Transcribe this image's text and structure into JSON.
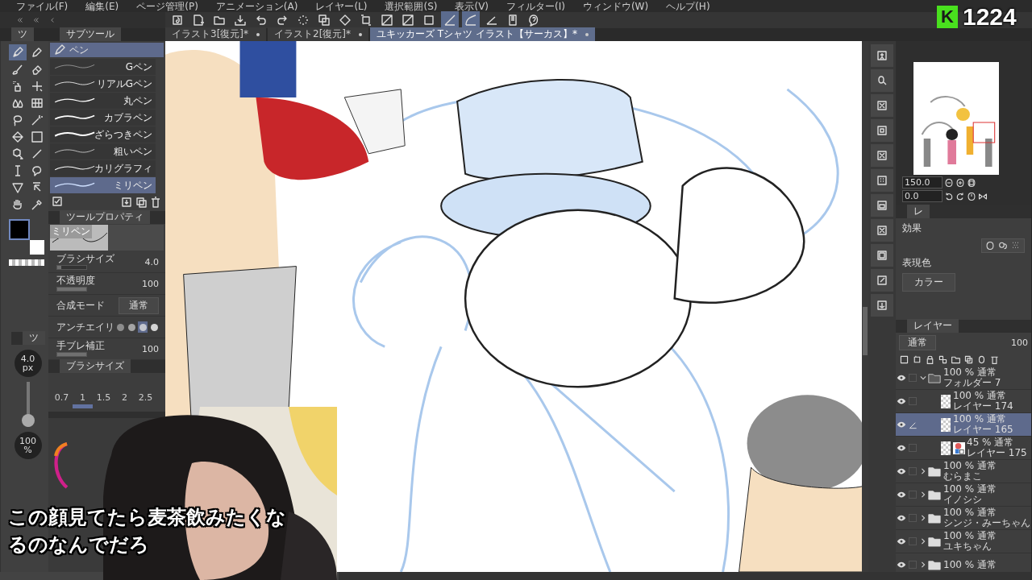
{
  "menu": [
    "ファイル(F)",
    "編集(E)",
    "ページ管理(P)",
    "アニメーション(A)",
    "レイヤー(L)",
    "選択範囲(S)",
    "表示(V)",
    "フィルター(I)",
    "ウィンドウ(W)",
    "ヘルプ(H)"
  ],
  "tool_panel_tab": "ツ",
  "subtool_panel_tab": "サブツール",
  "document_tabs": [
    {
      "label": "イラスト3[復元]*",
      "selected": false
    },
    {
      "label": "イラスト2[復元]*",
      "selected": false
    },
    {
      "label": "ユキッカーズ Tシャツ イラスト【サーカス】*",
      "selected": true
    }
  ],
  "tools": [
    {
      "selected": true
    },
    {
      "selected": false
    },
    {
      "selected": false
    },
    {
      "selected": false
    },
    {
      "selected": false
    },
    {
      "selected": false
    },
    {
      "selected": false
    },
    {
      "selected": false
    },
    {
      "selected": false
    },
    {
      "selected": false
    },
    {
      "selected": false
    },
    {
      "selected": false
    },
    {
      "selected": false
    },
    {
      "selected": false
    },
    {
      "selected": false
    },
    {
      "selected": false
    },
    {
      "selected": false
    },
    {
      "selected": false
    },
    {
      "selected": false
    },
    {
      "selected": false
    }
  ],
  "subtool": {
    "group": "ペン",
    "brushes": [
      {
        "name": "Gペン",
        "selected": false
      },
      {
        "name": "リアルGペン",
        "selected": false
      },
      {
        "name": "丸ペン",
        "selected": false
      },
      {
        "name": "カブラペン",
        "selected": false
      },
      {
        "name": "ざらつきペン",
        "selected": false
      },
      {
        "name": "粗いペン",
        "selected": false
      },
      {
        "name": "カリグラフィ",
        "selected": false
      },
      {
        "name": "ミリペン",
        "selected": true
      }
    ]
  },
  "tool_property": {
    "tab": "ツールプロパティ",
    "preview_label": "ミリペン",
    "rows": [
      {
        "kind": "slider",
        "label": "ブラシサイズ",
        "value": "4.0",
        "level": 0.15
      },
      {
        "kind": "slider",
        "label": "不透明度",
        "value": "100",
        "level": 1
      },
      {
        "kind": "select",
        "label": "合成モード",
        "value": "通常"
      },
      {
        "kind": "antialias",
        "label": "アンチエイリ",
        "options": [
          {
            "selected": false
          },
          {
            "selected": false
          },
          {
            "selected": true
          },
          {
            "selected": false
          }
        ]
      },
      {
        "kind": "slider",
        "label": "手ブレ補正",
        "value": "100",
        "level": 1
      }
    ]
  },
  "size_panel": {
    "tab": "ツ",
    "level": 0.0,
    "size": "4.0",
    "size_unit": "px",
    "opacity": "100",
    "opacity_unit": "%"
  },
  "brush_size": {
    "tab": "ブラシサイズ",
    "sizes": [
      {
        "label": "0.7",
        "selected": false
      },
      {
        "label": "1",
        "selected": true
      },
      {
        "label": "1.5",
        "selected": false
      },
      {
        "label": "2",
        "selected": false
      },
      {
        "label": "2.5",
        "selected": false
      }
    ]
  },
  "navigator": {
    "zoom": "150.0",
    "angle": "0.0"
  },
  "layer_property": {
    "tab": "レ",
    "effect_label": "効果",
    "color_label": "表現色",
    "color_mode": "カラー"
  },
  "layers_panel": {
    "tab": "レイヤー",
    "blend": "通常",
    "opacity": "100",
    "layers": [
      {
        "kind": "folder",
        "info": "100 % 通常",
        "name": "フォルダー 7",
        "visible": true,
        "expanded": true,
        "selected": false,
        "children": [
          {
            "kind": "layer",
            "info": "100 % 通常",
            "name": "レイヤー 174",
            "visible": true,
            "selected": false
          },
          {
            "kind": "layer",
            "info": "100 % 通常",
            "name": "レイヤー 165",
            "visible": true,
            "selected": true
          },
          {
            "kind": "masked",
            "info": "45 % 通常",
            "name": "レイヤー 175",
            "visible": true,
            "selected": false
          }
        ]
      },
      {
        "kind": "folder",
        "info": "100 % 通常",
        "name": "むらまこ",
        "visible": true,
        "expanded": false,
        "selected": false
      },
      {
        "kind": "folder",
        "info": "100 % 通常",
        "name": "イノシシ",
        "visible": true,
        "expanded": false,
        "selected": false
      },
      {
        "kind": "folder",
        "info": "100 % 通常",
        "name": "シンジ・みーちゃん",
        "visible": true,
        "expanded": false,
        "selected": false
      },
      {
        "kind": "folder",
        "info": "100 % 通常",
        "name": "ユキちゃん",
        "visible": true,
        "expanded": false,
        "selected": false
      },
      {
        "kind": "folder",
        "info": "100 % 通常",
        "visible": true,
        "expanded": false,
        "selected": false
      }
    ]
  },
  "overlay": {
    "logo_letter": "K",
    "count": "1224",
    "subtitle_lines": [
      "この顔見てたら麦茶飲みたくな",
      "るのなんでだろ"
    ]
  }
}
